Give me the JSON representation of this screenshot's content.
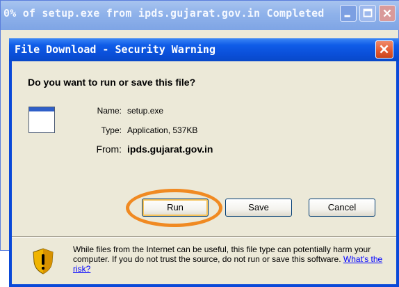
{
  "background_window": {
    "title": "0% of setup.exe from ipds.gujarat.gov.in Completed"
  },
  "dialog": {
    "title": "File Download - Security Warning",
    "question": "Do you want to run or save this file?",
    "file": {
      "name_label": "Name:",
      "name_value": "setup.exe",
      "type_label": "Type:",
      "type_value": "Application, 537KB",
      "from_label": "From:",
      "from_value": "ipds.gujarat.gov.in"
    },
    "buttons": {
      "run": "Run",
      "save": "Save",
      "cancel": "Cancel"
    },
    "warning": {
      "text": "While files from the Internet can be useful, this file type can potentially harm your computer. If you do not trust the source, do not run or save this software.",
      "link": "What's the risk?"
    }
  },
  "colors": {
    "titlebar_active": "#0a4fd8",
    "highlight_ring": "#f08a22",
    "dialog_face": "#ece9d8"
  },
  "icons": [
    "minimize-icon",
    "maximize-icon",
    "close-icon",
    "application-file-icon",
    "security-shield-icon"
  ]
}
